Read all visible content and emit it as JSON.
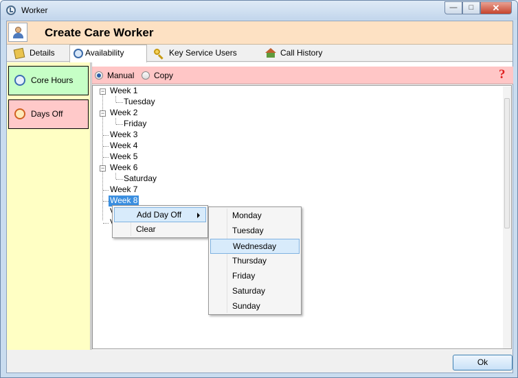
{
  "window": {
    "title": "Worker"
  },
  "header": {
    "title": "Create Care Worker"
  },
  "tabs": [
    {
      "label": "Details",
      "icon": "details-icon"
    },
    {
      "label": "Availability",
      "icon": "clock-icon",
      "active": true
    },
    {
      "label": "Key Service Users",
      "icon": "key-icon"
    },
    {
      "label": "Call History",
      "icon": "house-icon"
    }
  ],
  "sidebar": {
    "items": [
      {
        "label": "Core Hours",
        "color": "#c6ffc6"
      },
      {
        "label": "Days Off",
        "color": "#ffc9c9"
      }
    ]
  },
  "mode": {
    "options": [
      "Manual",
      "Copy"
    ],
    "selected": "Manual",
    "help": "?"
  },
  "tree": {
    "weeks": [
      {
        "label": "Week 1",
        "days": [
          "Tuesday"
        ]
      },
      {
        "label": "Week 2",
        "days": [
          "Friday"
        ]
      },
      {
        "label": "Week 3",
        "days": []
      },
      {
        "label": "Week 4",
        "days": []
      },
      {
        "label": "Week 5",
        "days": []
      },
      {
        "label": "Week 6",
        "days": [
          "Saturday"
        ]
      },
      {
        "label": "Week 7",
        "days": []
      },
      {
        "label": "Week 8",
        "days": [],
        "selected": true
      }
    ],
    "partial_hidden": [
      "V",
      "V"
    ]
  },
  "context_menu": {
    "items": [
      "Add Day Off",
      "Clear"
    ],
    "hovered": "Add Day Off"
  },
  "submenu": {
    "items": [
      "Monday",
      "Tuesday",
      "Wednesday",
      "Thursday",
      "Friday",
      "Saturday",
      "Sunday"
    ],
    "hovered": "Wednesday"
  },
  "footer": {
    "ok_label": "Ok"
  },
  "colors": {
    "header_bg": "#fde1c3",
    "sidebar_bg": "#ffffc4",
    "radio_bar_bg": "#ffc6c6",
    "selection": "#3b8fe0"
  }
}
